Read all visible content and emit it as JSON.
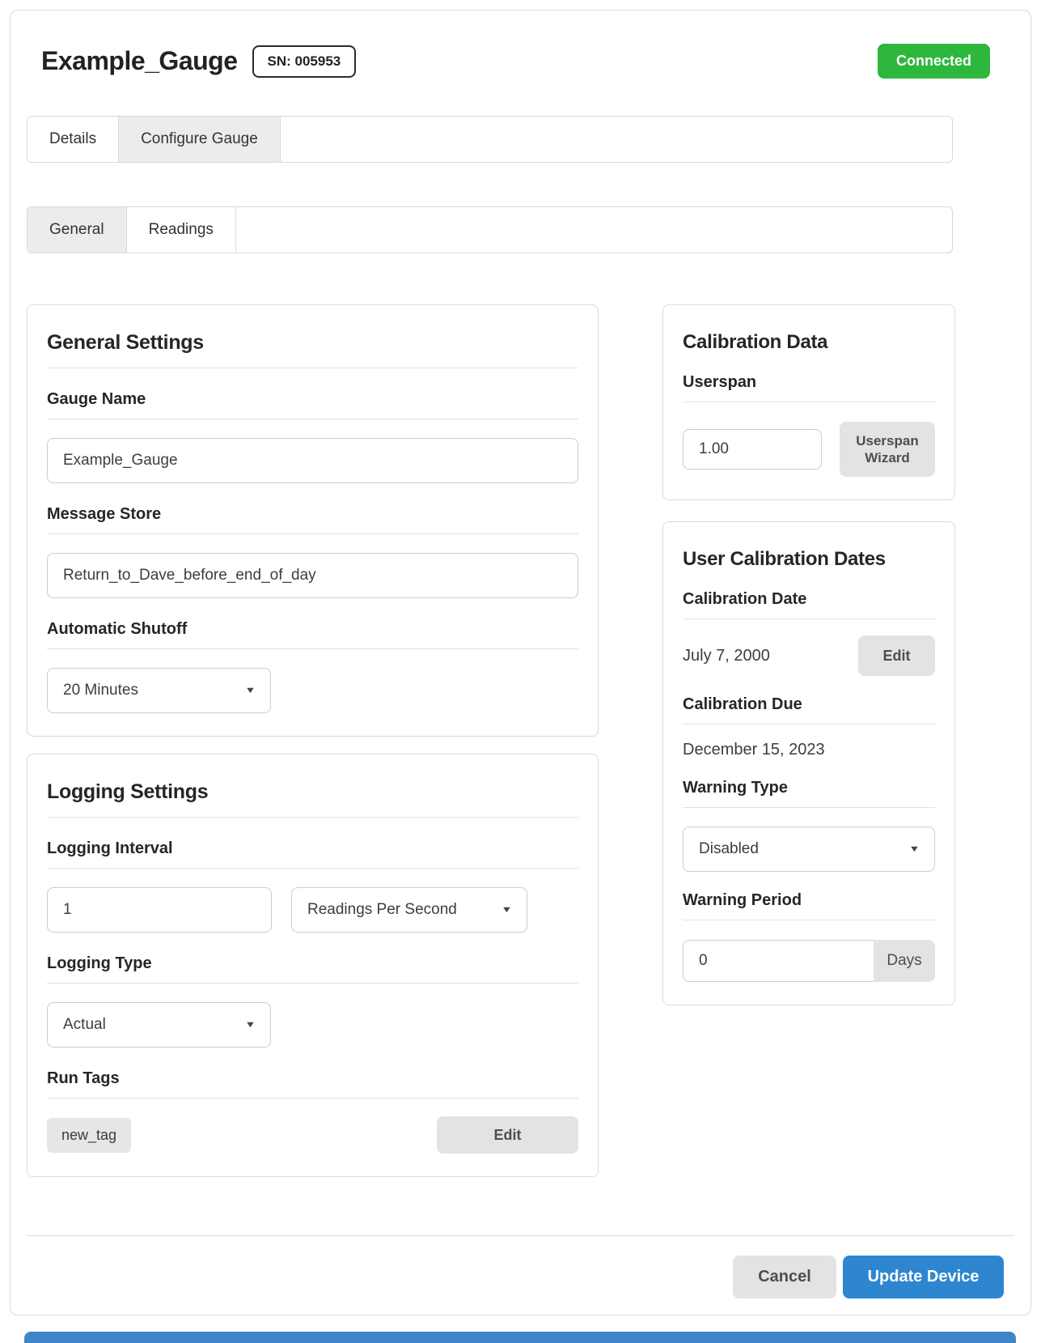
{
  "header": {
    "title": "Example_Gauge",
    "serial_label": "SN: 005953",
    "status": "Connected"
  },
  "tabs": {
    "items": [
      {
        "label": "Details",
        "active": false
      },
      {
        "label": "Configure Gauge",
        "active": true
      }
    ]
  },
  "subtabs": {
    "items": [
      {
        "label": "General",
        "active": true
      },
      {
        "label": "Readings",
        "active": false
      }
    ]
  },
  "general_settings": {
    "title": "General Settings",
    "gauge_name_label": "Gauge Name",
    "gauge_name_value": "Example_Gauge",
    "message_store_label": "Message Store",
    "message_store_value": "Return_to_Dave_before_end_of_day",
    "automatic_shutoff_label": "Automatic Shutoff",
    "automatic_shutoff_value": "20 Minutes"
  },
  "logging_settings": {
    "title": "Logging Settings",
    "logging_interval_label": "Logging Interval",
    "logging_interval_value": "1",
    "logging_interval_unit": "Readings Per Second",
    "logging_type_label": "Logging Type",
    "logging_type_value": "Actual",
    "run_tags_label": "Run Tags",
    "run_tags": [
      "new_tag"
    ],
    "edit_button_label": "Edit"
  },
  "calibration_data": {
    "title": "Calibration Data",
    "userspan_label": "Userspan",
    "userspan_value": "1.00",
    "wizard_button_label": "Userspan Wizard"
  },
  "user_calibration_dates": {
    "title": "User Calibration Dates",
    "calibration_date_label": "Calibration Date",
    "calibration_date_value": "July 7, 2000",
    "edit_button_label": "Edit",
    "calibration_due_label": "Calibration Due",
    "calibration_due_value": "December 15, 2023",
    "warning_type_label": "Warning Type",
    "warning_type_value": "Disabled",
    "warning_period_label": "Warning Period",
    "warning_period_value": "0",
    "warning_period_unit": "Days"
  },
  "footer": {
    "cancel_label": "Cancel",
    "update_label": "Update Device"
  },
  "icons": {
    "dropdown_caret": "▼"
  },
  "colors": {
    "connected_green": "#2eb73d",
    "primary_blue": "#2e86d1",
    "bottom_bar_blue": "#3e86c9"
  }
}
